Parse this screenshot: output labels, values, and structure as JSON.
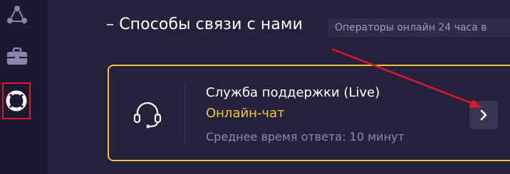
{
  "sidebar": {
    "items": [
      {
        "icon": "network-icon"
      },
      {
        "icon": "briefcase-icon"
      },
      {
        "icon": "lifebuoy-icon",
        "highlighted": true
      }
    ]
  },
  "contact": {
    "title": "– Способы связи с нами",
    "operators_badge": "Операторы онлайн 24 часа в"
  },
  "support_card": {
    "icon": "headset-icon",
    "title": "Служба поддержки (Live)",
    "subtitle": "Онлайн-чат",
    "response_time": "Среднее время ответа: 10 минут",
    "action_icon": "chevron-right-icon"
  },
  "colors": {
    "accent": "#f2c23a",
    "highlight": "#e4162a",
    "background": "#24213b",
    "sidebar": "#1c1a31"
  }
}
